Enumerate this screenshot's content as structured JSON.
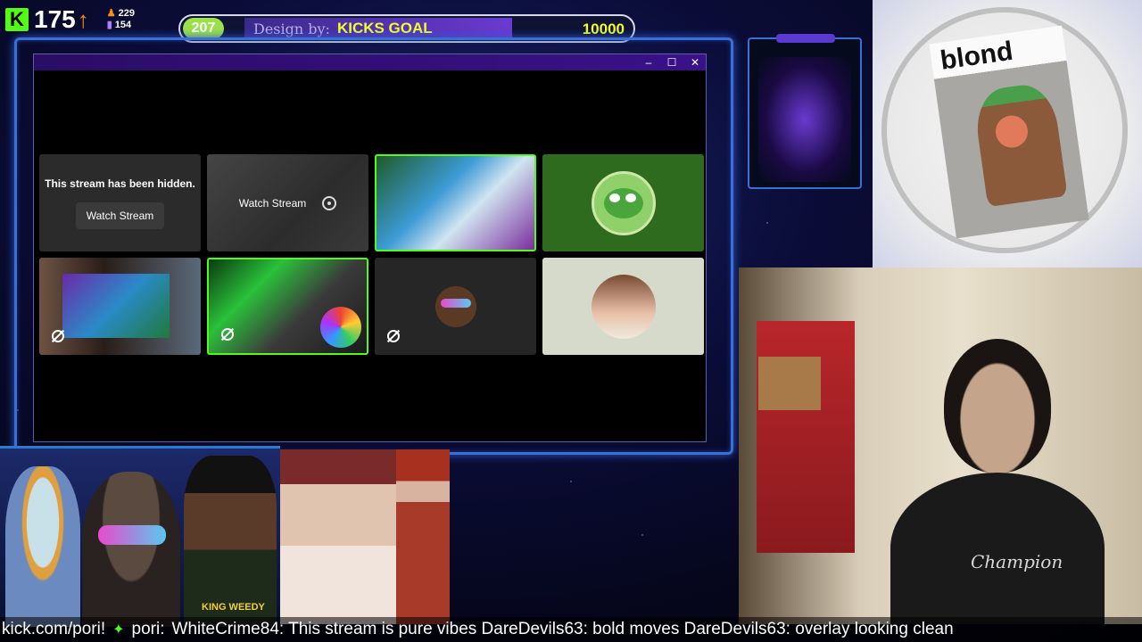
{
  "stats": {
    "followers": "175",
    "stat_a": "229",
    "stat_b": "154"
  },
  "goal": {
    "current": "207",
    "prefix": "Design by:",
    "title": "KICKS GOAL",
    "target": "10000"
  },
  "window": {
    "minimize": "–",
    "maximize": "☐",
    "close": "✕"
  },
  "tiles": {
    "hidden_message": "This stream has been hidden.",
    "watch_button_1": "Watch Stream",
    "watch_button_2": "Watch Stream"
  },
  "album": {
    "title": "blond"
  },
  "overlay": {
    "shirt_text": "Champion",
    "weedy_text": "KING WEEDY"
  },
  "ticker": {
    "site": "kick.com/pori!",
    "user": "pori:",
    "messages": "WhiteCrime84: This stream is pure vibes DareDevils63: bold moves DareDevils63: overlay looking clean"
  },
  "colors": {
    "kick_green": "#53fc18",
    "goal_yellow": "#f4ff2a",
    "frame_blue": "#3a6fd8",
    "titlebar_purple": "#2a0d66"
  }
}
